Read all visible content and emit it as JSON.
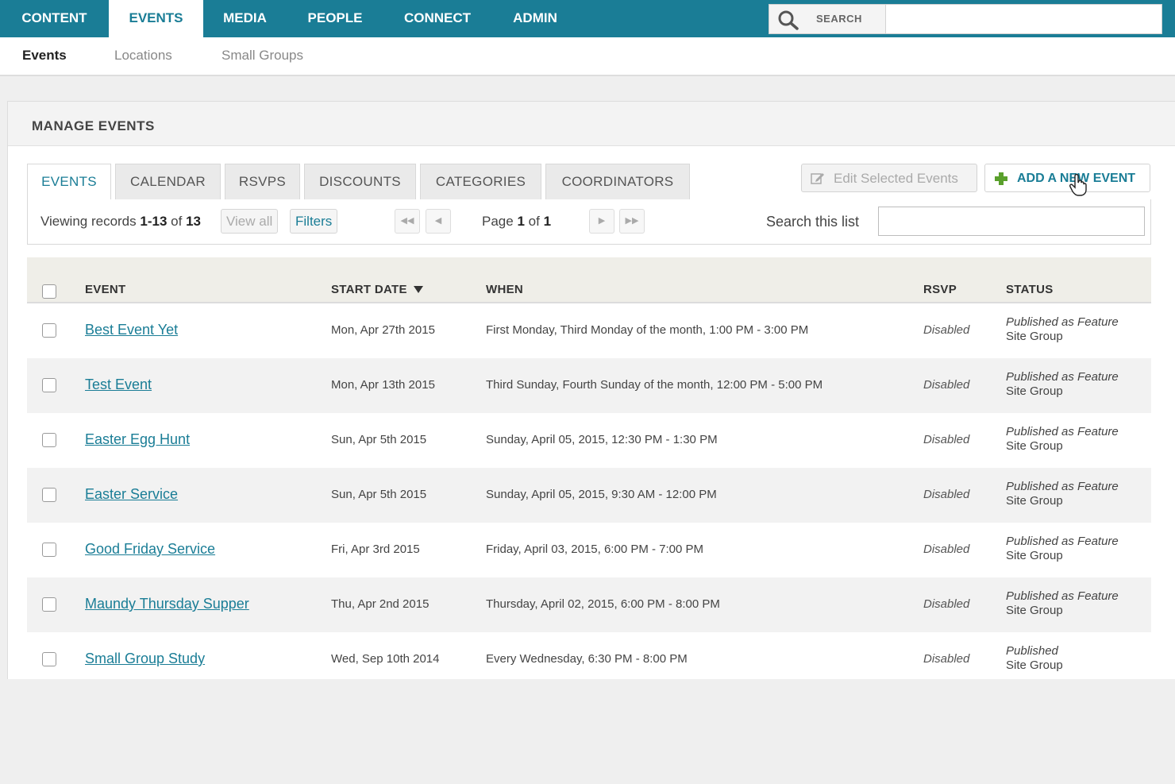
{
  "topnav": {
    "items": [
      "CONTENT",
      "EVENTS",
      "MEDIA",
      "PEOPLE",
      "CONNECT",
      "ADMIN"
    ],
    "active": "EVENTS",
    "search_label": "SEARCH",
    "search_value": ""
  },
  "subnav": {
    "items": [
      "Events",
      "Locations",
      "Small Groups"
    ],
    "active": "Events"
  },
  "panel": {
    "title": "MANAGE EVENTS",
    "tabs": [
      "EVENTS",
      "CALENDAR",
      "RSVPS",
      "DISCOUNTS",
      "CATEGORIES",
      "COORDINATORS"
    ],
    "active_tab": "EVENTS",
    "edit_button": "Edit Selected Events",
    "add_button": "ADD A NEW EVENT"
  },
  "toolbar": {
    "viewing_prefix": "Viewing records",
    "range": "1-13",
    "of_text": "of",
    "total": "13",
    "view_all": "View all",
    "filters": "Filters",
    "page_prefix": "Page",
    "page_current": "1",
    "page_of": "of",
    "page_total": "1",
    "search_label": "Search this list",
    "search_value": ""
  },
  "table": {
    "headers": {
      "event": "EVENT",
      "start_date": "START DATE",
      "when": "WHEN",
      "rsvp": "RSVP",
      "status": "STATUS"
    },
    "rows": [
      {
        "name": "Best Event Yet",
        "date": "Mon, Apr 27th 2015",
        "when": "First Monday, Third Monday of the month, 1:00 PM - 3:00 PM",
        "rsvp": "Disabled",
        "status1": "Published as Feature",
        "status2": "Site Group"
      },
      {
        "name": "Test Event",
        "date": "Mon, Apr 13th 2015",
        "when": "Third Sunday, Fourth Sunday of the month, 12:00 PM - 5:00 PM",
        "rsvp": "Disabled",
        "status1": "Published as Feature",
        "status2": "Site Group"
      },
      {
        "name": "Easter Egg Hunt",
        "date": "Sun, Apr 5th 2015",
        "when": "Sunday, April 05, 2015, 12:30 PM - 1:30 PM",
        "rsvp": "Disabled",
        "status1": "Published as Feature",
        "status2": "Site Group"
      },
      {
        "name": "Easter Service",
        "date": "Sun, Apr 5th 2015",
        "when": "Sunday, April 05, 2015, 9:30 AM - 12:00 PM",
        "rsvp": "Disabled",
        "status1": "Published as Feature",
        "status2": "Site Group"
      },
      {
        "name": "Good Friday Service",
        "date": "Fri, Apr 3rd 2015",
        "when": "Friday, April 03, 2015, 6:00 PM - 7:00 PM",
        "rsvp": "Disabled",
        "status1": "Published as Feature",
        "status2": "Site Group"
      },
      {
        "name": "Maundy Thursday Supper",
        "date": "Thu, Apr 2nd 2015",
        "when": "Thursday, April 02, 2015, 6:00 PM - 8:00 PM",
        "rsvp": "Disabled",
        "status1": "Published as Feature",
        "status2": "Site Group"
      },
      {
        "name": "Small Group Study",
        "date": "Wed, Sep 10th 2014",
        "when": "Every Wednesday, 6:30 PM - 8:00 PM",
        "rsvp": "Disabled",
        "status1": "Published",
        "status2": "Site Group"
      }
    ]
  },
  "icons": {
    "search": "search-icon",
    "edit": "edit-icon",
    "add": "plus-icon",
    "sort": "sort-desc-icon",
    "first": "first-page-icon",
    "prev": "prev-page-icon",
    "next": "next-page-icon",
    "last": "last-page-icon"
  },
  "colors": {
    "brand": "#1a7d96",
    "add_icon": "#5aa02c"
  }
}
